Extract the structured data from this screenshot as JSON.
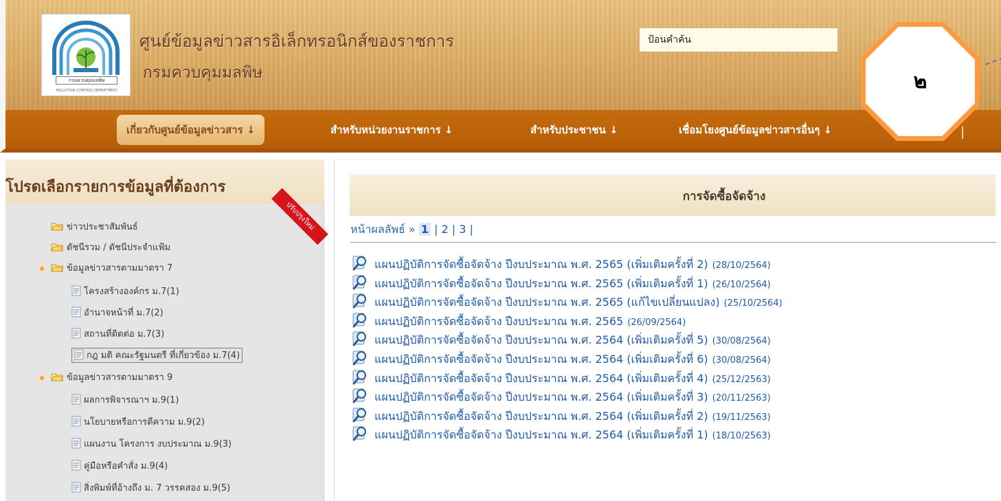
{
  "header": {
    "site_title": "ศูนย์ข้อมูลข่าวสารอิเล็กทรอนิกส์ของราชการ",
    "site_subtitle": "กรมควบคุมมลพิษ",
    "logo_caption": "กรมควบคุมมลพิษ",
    "logo_caption_sub": "POLLUTION CONTROL DEPARTMENT",
    "search_placeholder": "ป้อนคำค้น"
  },
  "nav": {
    "items": [
      {
        "label": "เกี่ยวกับศูนย์ข้อมูลข่าวสาร ↓",
        "active": true
      },
      {
        "label": "สำหรับหน่วยงานราชการ ↓",
        "active": false
      },
      {
        "label": "สำหรับประชาชน ↓",
        "active": false
      },
      {
        "label": "เชื่อมโยงศูนย์ข้อมูลข่าวสารอื่นๆ ↓",
        "active": false
      }
    ],
    "separator": "|"
  },
  "callout": {
    "label": "๒"
  },
  "sidebar": {
    "title": "โปรดเลือกรายการข้อมูลที่ต้องการ",
    "ribbon": "ปรับปรุงใหม่",
    "items": [
      {
        "label": "ข่าวประชาสัมพันธ์",
        "type": "folder",
        "level": 0
      },
      {
        "label": "ดัชนีรวม / ดัชนีประจำแฟ้ม",
        "type": "folder",
        "level": 0
      },
      {
        "label": "ข้อมูลข่าวสารตามมาตรา 7",
        "type": "folder-bullet",
        "level": 0
      },
      {
        "label": "โครงสร้างองค์กร ม.7(1)",
        "type": "doc",
        "level": 1
      },
      {
        "label": "อำนาจหน้าที่ ม.7(2)",
        "type": "doc",
        "level": 1
      },
      {
        "label": "สถานที่ติดต่อ ม.7(3)",
        "type": "doc",
        "level": 1
      },
      {
        "label": "กฎ มติ คณะรัฐมนตรี ที่เกี่ยวข้อง ม.7(4)",
        "type": "doc",
        "level": 1,
        "highlight": true
      },
      {
        "label": "ข้อมูลข่าวสารตามมาตรา 9",
        "type": "folder-bullet",
        "level": 0
      },
      {
        "label": "ผลการพิจารณาฯ ม.9(1)",
        "type": "doc",
        "level": 1
      },
      {
        "label": "นโยบายหรือการตีความ ม.9(2)",
        "type": "doc",
        "level": 1
      },
      {
        "label": "แผนงาน โครงการ งบประมาณ ม.9(3)",
        "type": "doc",
        "level": 1
      },
      {
        "label": "คู่มือหรือคำสั่ง ม.9(4)",
        "type": "doc",
        "level": 1
      },
      {
        "label": "สิ่งพิมพ์ที่อ้างถึง ม. 7 วรรคสอง ม.9(5)",
        "type": "doc",
        "level": 1
      }
    ]
  },
  "main": {
    "title": "การจัดซื้อจัดจ้าง",
    "pager_label": "หน้าผลลัพธ์ »",
    "pages": [
      "1",
      "2",
      "3"
    ],
    "current_page": "1",
    "pager_sep": "|",
    "documents": [
      {
        "title": "แผนปฏิบัติการจัดซื้อจัดจ้าง ปีงบประมาณ พ.ศ. 2565 (เพิ่มเติมครั้งที่ 2)",
        "date": "(28/10/2564)"
      },
      {
        "title": "แผนปฏิบัติการจัดซื้อจัดจ้าง ปีงบประมาณ พ.ศ. 2565 (เพิ่มเติมครั้งที่ 1)",
        "date": "(26/10/2564)"
      },
      {
        "title": "แผนปฏิบัติการจัดซื้อจัดจ้าง ปีงบประมาณ พ.ศ. 2565 (แก้ไขเปลี่ยนแปลง)",
        "date": "(25/10/2564)"
      },
      {
        "title": "แผนปฏิบัติการจัดซื้อจัดจ้าง ปีงบประมาณ พ.ศ. 2565",
        "date": "(26/09/2564)"
      },
      {
        "title": "แผนปฏิบัติการจัดซื้อจัดจ้าง ปีงบประมาณ พ.ศ. 2564 (เพิ่มเติมครั้งที่ 5)",
        "date": "(30/08/2564)"
      },
      {
        "title": "แผนปฏิบัติการจัดซื้อจัดจ้าง ปีงบประมาณ พ.ศ. 2564 (เพิ่มเติมครั้งที่ 6)",
        "date": "(30/08/2564)"
      },
      {
        "title": "แผนปฏิบัติการจัดซื้อจัดจ้าง ปีงบประมาณ พ.ศ. 2564 (เพิ่มเติมครั้งที่ 4)",
        "date": "(25/12/2563)"
      },
      {
        "title": "แผนปฏิบัติการจัดซื้อจัดจ้าง ปีงบประมาณ พ.ศ. 2564 (เพิ่มเติมครั้งที่ 3)",
        "date": "(20/11/2563)"
      },
      {
        "title": "แผนปฏิบัติการจัดซื้อจัดจ้าง ปีงบประมาณ พ.ศ. 2564 (เพิ่มเติมครั้งที่ 2)",
        "date": "(19/11/2563)"
      },
      {
        "title": "แผนปฏิบัติการจัดซื้อจัดจ้าง ปีงบประมาณ พ.ศ. 2564 (เพิ่มเติมครั้งที่ 1)",
        "date": "(18/10/2563)"
      }
    ]
  },
  "icons": {
    "folder": "folder-icon",
    "doc": "document-icon",
    "magnifier": "magnifier-icon"
  },
  "colors": {
    "header": "#dcab63",
    "nav": "#b75d07",
    "link": "#1e5aa8",
    "callout_border": "#ff9a3f"
  }
}
